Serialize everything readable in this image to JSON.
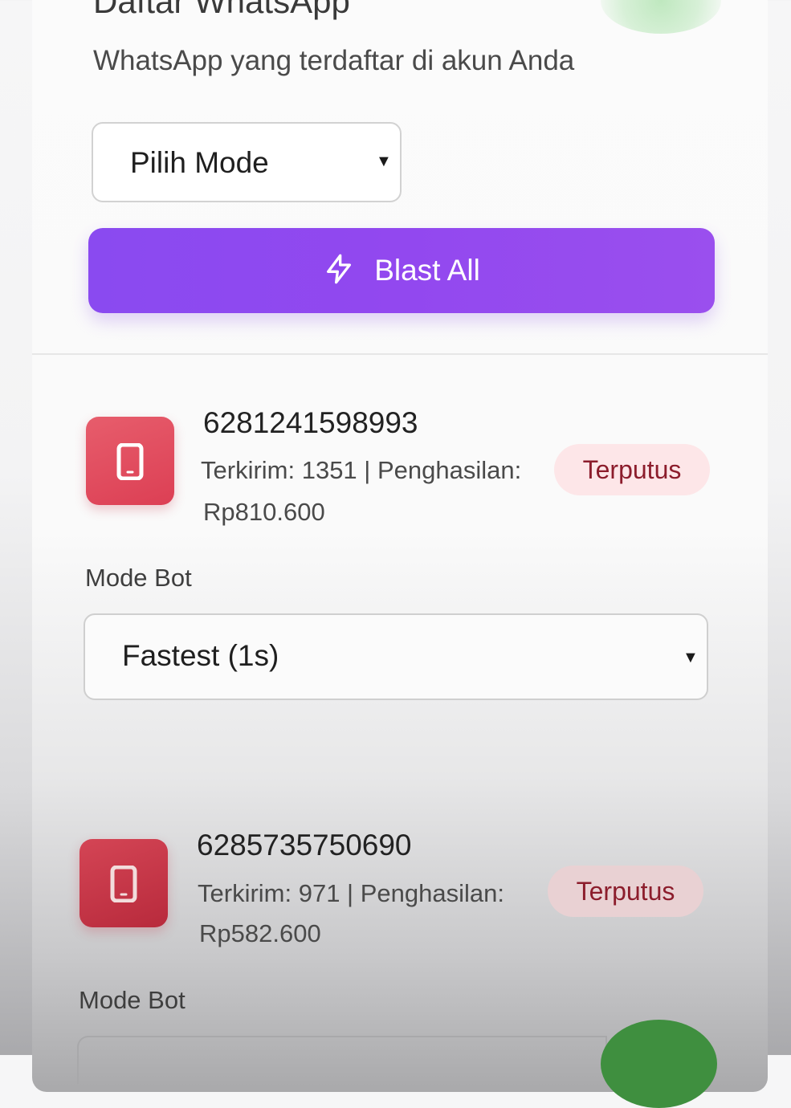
{
  "header": {
    "title": "Daftar WhatsApp",
    "subtitle": "WhatsApp yang terdaftar di akun Anda"
  },
  "controls": {
    "mode_select_value": "Pilih Mode",
    "blast_button_label": "Blast All",
    "blast_icon": "lightning-icon",
    "accent_color": "#9248ef"
  },
  "accounts": [
    {
      "number": "6281241598993",
      "stats": "Terkirim: 1351 | Penghasilan:",
      "income": "Rp810.600",
      "status": "Terputus",
      "icon": "phone-icon",
      "mode_label": "Mode Bot",
      "mode_value": "Fastest (1s)"
    },
    {
      "number": "6285735750690",
      "stats": "Terkirim: 971 | Penghasilan:",
      "income": "Rp582.600",
      "status": "Terputus",
      "icon": "phone-icon",
      "mode_label": "Mode Bot"
    }
  ],
  "colors": {
    "badge_red": "#dc3f54",
    "status_bg": "#fde6e8",
    "status_text": "#8c1d2c"
  }
}
